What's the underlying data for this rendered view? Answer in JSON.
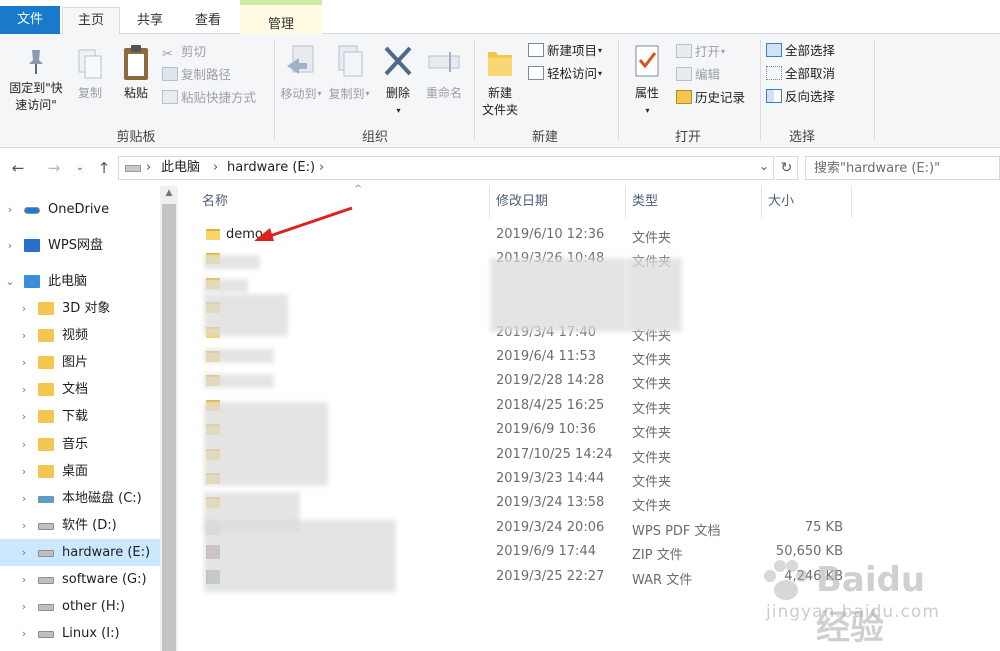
{
  "tabs": {
    "file": "文件",
    "home": "主页",
    "share": "共享",
    "view": "查看",
    "manage": "管理"
  },
  "ribbon": {
    "clipboard": {
      "pin": "固定到\"快速访问\"",
      "copy": "复制",
      "paste": "粘贴",
      "cut": "剪切",
      "copy_path": "复制路径",
      "paste_shortcut": "粘贴快捷方式",
      "label": "剪贴板"
    },
    "organize": {
      "move_to": "移动到",
      "copy_to": "复制到",
      "delete": "删除",
      "rename": "重命名",
      "label": "组织"
    },
    "new": {
      "new_folder": "新建\n文件夹",
      "new_item": "新建项目",
      "easy_access": "轻松访问",
      "label": "新建"
    },
    "open": {
      "properties": "属性",
      "open": "打开",
      "edit": "编辑",
      "history": "历史记录",
      "label": "打开"
    },
    "select": {
      "select_all": "全部选择",
      "select_none": "全部取消",
      "invert": "反向选择",
      "label": "选择"
    }
  },
  "address": {
    "this_pc": "此电脑",
    "drive": "hardware (E:)"
  },
  "search": {
    "placeholder": "搜索\"hardware (E:)\""
  },
  "nav": [
    {
      "label": "OneDrive",
      "indent": 0,
      "icon": "onedrive-icon"
    },
    {
      "label": "WPS网盘",
      "indent": 0,
      "icon": "wps-cloud-icon"
    },
    {
      "label": "此电脑",
      "indent": 0,
      "icon": "pc-icon",
      "expanded": true
    },
    {
      "label": "3D 对象",
      "indent": 1,
      "icon": "3d-objects-icon"
    },
    {
      "label": "视频",
      "indent": 1,
      "icon": "video-folder-icon"
    },
    {
      "label": "图片",
      "indent": 1,
      "icon": "pictures-folder-icon"
    },
    {
      "label": "文档",
      "indent": 1,
      "icon": "documents-folder-icon"
    },
    {
      "label": "下载",
      "indent": 1,
      "icon": "downloads-folder-icon"
    },
    {
      "label": "音乐",
      "indent": 1,
      "icon": "music-folder-icon"
    },
    {
      "label": "桌面",
      "indent": 1,
      "icon": "desktop-folder-icon"
    },
    {
      "label": "本地磁盘 (C:)",
      "indent": 1,
      "icon": "windows-drive-icon"
    },
    {
      "label": "软件 (D:)",
      "indent": 1,
      "icon": "drive-icon"
    },
    {
      "label": "hardware (E:)",
      "indent": 1,
      "icon": "drive-icon",
      "selected": true
    },
    {
      "label": "software (G:)",
      "indent": 1,
      "icon": "drive-icon"
    },
    {
      "label": "other (H:)",
      "indent": 1,
      "icon": "drive-icon"
    },
    {
      "label": "Linux (I:)",
      "indent": 1,
      "icon": "drive-icon"
    }
  ],
  "columns": {
    "name": "名称",
    "date": "修改日期",
    "type": "类型",
    "size": "大小"
  },
  "files": [
    {
      "name": "demo",
      "date": "2019/6/10 12:36",
      "type": "文件夹",
      "size": "",
      "kind": "folder"
    },
    {
      "name": "",
      "date": "2019/3/26 10:48",
      "type": "文件夹",
      "size": "",
      "kind": "folder"
    },
    {
      "name": "",
      "date": "",
      "type": "",
      "size": "",
      "kind": "folder"
    },
    {
      "name": "",
      "date": "",
      "type": "",
      "size": "",
      "kind": "folder"
    },
    {
      "name": "",
      "date": "2019/3/4 17:40",
      "type": "文件夹",
      "size": "",
      "kind": "folder"
    },
    {
      "name": "",
      "date": "2019/6/4 11:53",
      "type": "文件夹",
      "size": "",
      "kind": "folder"
    },
    {
      "name": "",
      "date": "2019/2/28 14:28",
      "type": "文件夹",
      "size": "",
      "kind": "folder"
    },
    {
      "name": "",
      "date": "2018/4/25 16:25",
      "type": "文件夹",
      "size": "",
      "kind": "folder"
    },
    {
      "name": "",
      "date": "2019/6/9 10:36",
      "type": "文件夹",
      "size": "",
      "kind": "folder"
    },
    {
      "name": "",
      "date": "2017/10/25 14:24",
      "type": "文件夹",
      "size": "",
      "kind": "folder"
    },
    {
      "name": "",
      "date": "2019/3/23 14:44",
      "type": "文件夹",
      "size": "",
      "kind": "folder"
    },
    {
      "name": "",
      "date": "2019/3/24 13:58",
      "type": "文件夹",
      "size": "",
      "kind": "folder"
    },
    {
      "name": "",
      "date": "2019/3/24 20:06",
      "type": "WPS PDF 文档",
      "size": "75 KB",
      "kind": "pdf"
    },
    {
      "name": "",
      "date": "2019/6/9 17:44",
      "type": "ZIP 文件",
      "size": "50,650 KB",
      "kind": "zip"
    },
    {
      "name": "",
      "date": "2019/3/25 22:27",
      "type": "WAR 文件",
      "size": "4,246 KB",
      "kind": "war"
    }
  ],
  "watermark": {
    "brand": "Baidu 经验",
    "url": "jingyan.baidu.com"
  },
  "colors": {
    "accent": "#1979ca",
    "selection": "#cce8ff",
    "folder": "#f3c64f",
    "arrow": "#e02020"
  }
}
